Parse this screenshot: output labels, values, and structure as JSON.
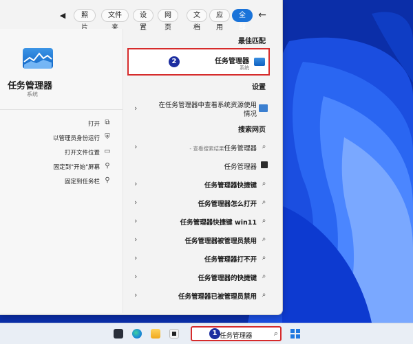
{
  "header": {
    "back_glyph": "←",
    "more_glyph": "◀",
    "chips": [
      {
        "label": "全部",
        "active": true
      },
      {
        "label": "应用"
      },
      {
        "label": "文档"
      },
      {
        "label": "网页"
      },
      {
        "label": "设置"
      },
      {
        "label": "文件夹"
      },
      {
        "label": "照片"
      }
    ]
  },
  "sections": {
    "best_match": "最佳匹配",
    "settings": "设置",
    "web": "搜索网页"
  },
  "best_match": {
    "title": "任务管理器",
    "subtitle": "系统",
    "icon": "task-manager-icon",
    "badge": "2"
  },
  "settings_result": {
    "line1": "在任务管理器中查看系统资源使用",
    "line2": "情况",
    "chevron": "›",
    "icon": "settings-monitor-icon"
  },
  "web_results": [
    {
      "text": "任务管理器",
      "sub": " - 查看搜索结果",
      "bold": false,
      "icon": "search-icon"
    },
    {
      "text": "任务管理器",
      "sub": "",
      "bold": false,
      "icon": "monitor-icon"
    },
    {
      "text": "任务管理器快捷键",
      "sub": "",
      "bold": true,
      "icon": "search-icon"
    },
    {
      "text": "任务管理器怎么打开",
      "sub": "",
      "bold": true,
      "icon": "search-icon"
    },
    {
      "text": "任务管理器快捷键 win11",
      "sub": "",
      "bold": true,
      "icon": "search-icon"
    },
    {
      "text": "任务管理器被管理员禁用",
      "sub": "",
      "bold": true,
      "icon": "search-icon"
    },
    {
      "text": "任务管理器打不开",
      "sub": "",
      "bold": true,
      "icon": "search-icon"
    },
    {
      "text": "任务管理器的快捷键",
      "sub": "",
      "bold": true,
      "icon": "search-icon"
    },
    {
      "text": "任务管理器已被管理员禁用",
      "sub": "",
      "bold": true,
      "icon": "search-icon"
    }
  ],
  "chevron": "›",
  "detail": {
    "title": "任务管理器",
    "subtitle": "系统",
    "actions": [
      {
        "label": "打开",
        "icon": "open-icon",
        "glyph": "⧉"
      },
      {
        "label": "以管理员身份运行",
        "icon": "admin-shield-icon",
        "glyph": "⛨"
      },
      {
        "label": "打开文件位置",
        "icon": "folder-icon",
        "glyph": "▭"
      },
      {
        "label": "固定到\"开始\"屏幕",
        "icon": "pin-icon",
        "glyph": "⚲"
      },
      {
        "label": "固定到任务栏",
        "icon": "pin-icon",
        "glyph": "⚲"
      }
    ]
  },
  "taskbar": {
    "search_value": "任务管理器",
    "search_badge": "1",
    "search_glyph": "⌕",
    "icons": [
      "terminal-icon",
      "folder-icon",
      "edge-icon",
      "store-icon"
    ]
  },
  "colors": {
    "accent": "#1a73d9",
    "highlight_border": "#d62b2b",
    "badge": "#1c2ea0"
  }
}
